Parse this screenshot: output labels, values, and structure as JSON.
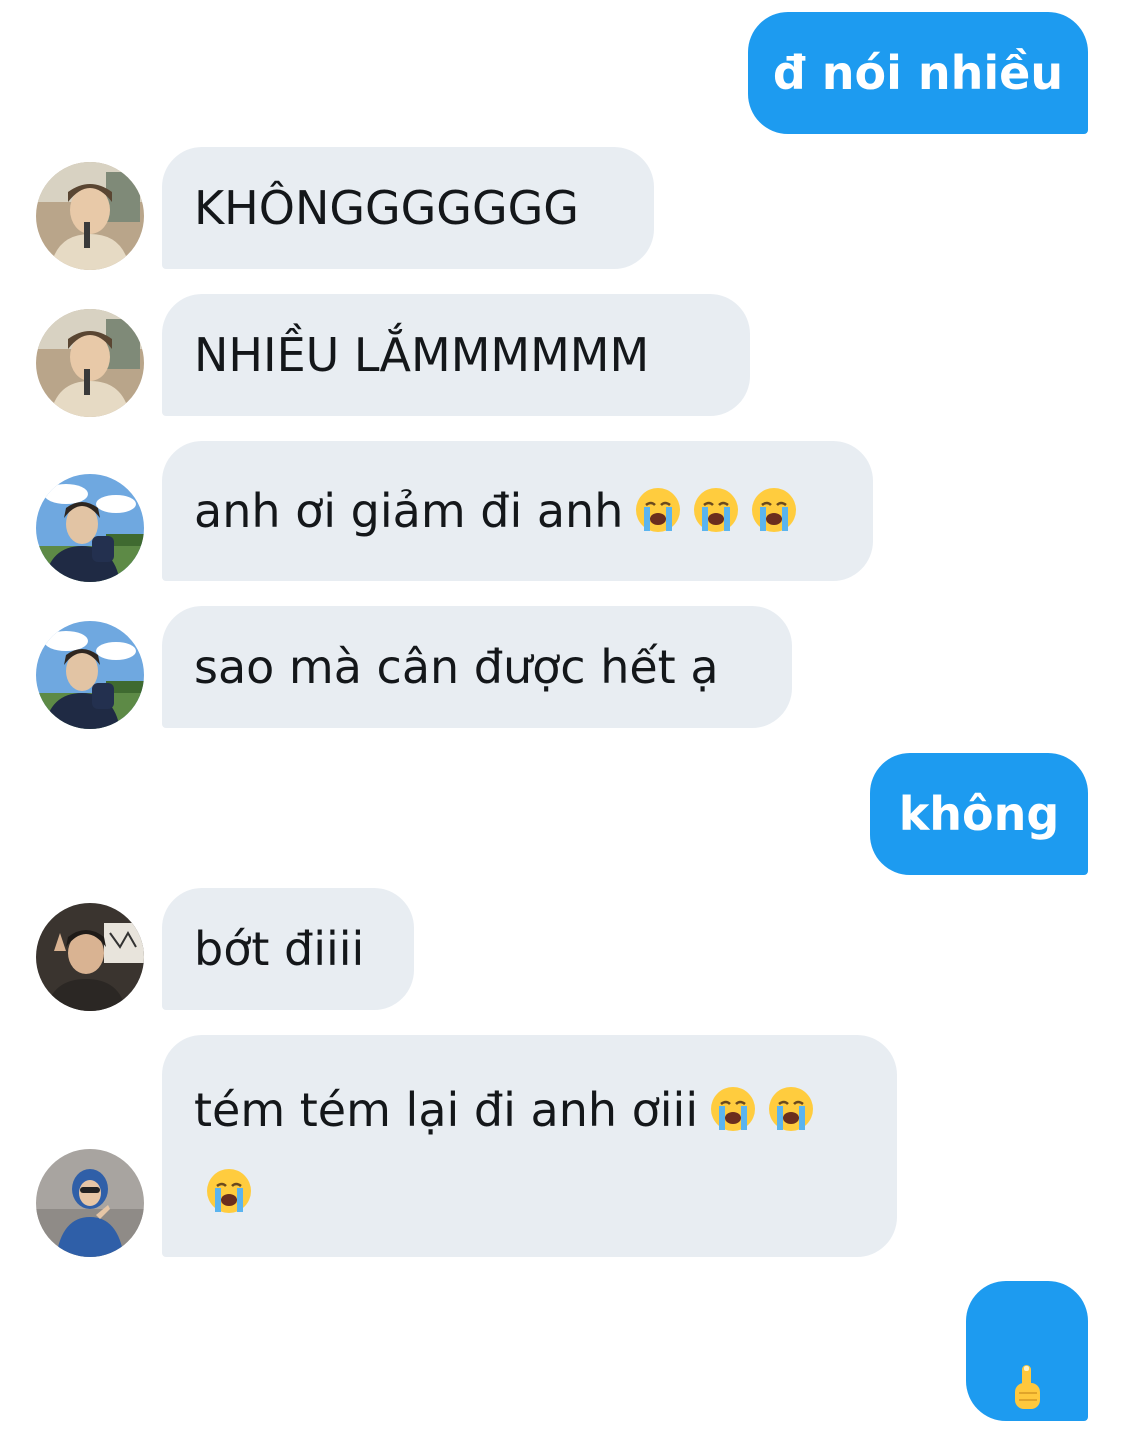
{
  "messages": [
    {
      "side": "out",
      "text": "đ nói nhiều"
    },
    {
      "side": "in",
      "text": "KHÔNGGGGGGG",
      "avatar": "avatar-boy-cafe"
    },
    {
      "side": "in",
      "text": "NHIỀU LẮMMMMMM",
      "avatar": "avatar-boy-cafe"
    },
    {
      "side": "in",
      "text": "anh ơi giảm đi anh",
      "emojis": [
        "loudly-crying-face-icon",
        "loudly-crying-face-icon",
        "loudly-crying-face-icon"
      ],
      "avatar": "avatar-boy-outdoor"
    },
    {
      "side": "in",
      "text": "sao mà cân được hết ạ",
      "avatar": "avatar-boy-outdoor"
    },
    {
      "side": "out",
      "text": "không"
    },
    {
      "side": "in",
      "text": "bớt điiii",
      "avatar": "avatar-boy-waving"
    },
    {
      "side": "in",
      "text": "tém tém lại đi anh ơiii",
      "emojis": [
        "loudly-crying-face-icon",
        "loudly-crying-face-icon",
        "loudly-crying-face-icon"
      ],
      "avatar": "avatar-boy-hoodie"
    },
    {
      "side": "out",
      "emojis": [
        "pointing-up-hand-icon"
      ]
    }
  ],
  "colors": {
    "outgoing_bubble": "#1d9bf0",
    "incoming_bubble": "#e8edf2",
    "incoming_text": "#14171a",
    "outgoing_text": "#ffffff"
  }
}
